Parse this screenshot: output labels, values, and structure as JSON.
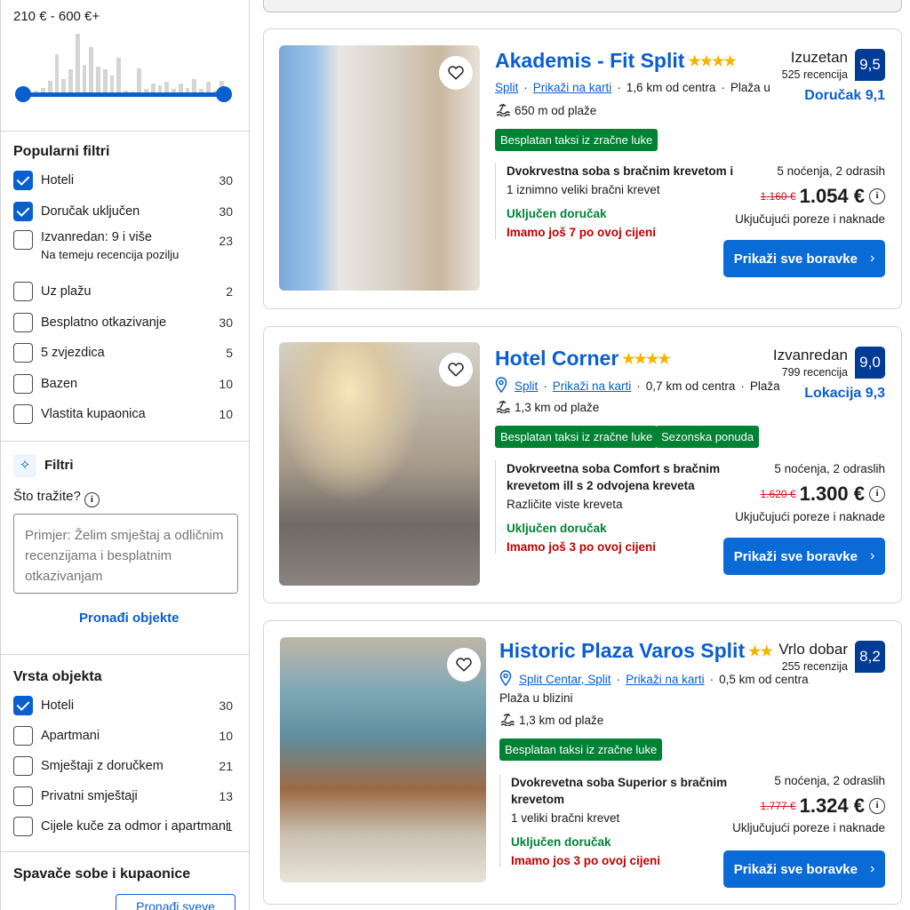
{
  "sidebar": {
    "price_range": "210 € - 600 €+",
    "price_histogram": [
      2,
      5,
      8,
      12,
      22,
      60,
      25,
      38,
      90,
      45,
      70,
      42,
      38,
      30,
      55,
      8,
      6,
      40,
      10,
      18,
      15,
      20,
      10,
      18,
      12,
      25,
      10,
      20,
      8,
      22
    ],
    "popular": {
      "title": "Popularni filtri",
      "items": [
        {
          "label": "Hoteli",
          "count": "30",
          "checked": true
        },
        {
          "label": "Doručak uključen",
          "count": "30",
          "checked": true
        },
        {
          "label": "Izvanredan: 9 i više",
          "sublabel": "Na temeju recencija pozilju",
          "count": "23",
          "checked": false
        },
        {
          "label": "Uz plažu",
          "count": "2",
          "checked": false
        },
        {
          "label": "Besplatno otkazivanje",
          "count": "30",
          "checked": false
        },
        {
          "label": "5 zvjezdica",
          "count": "5",
          "checked": false
        },
        {
          "label": "Bazen",
          "count": "10",
          "checked": false
        },
        {
          "label": "Vlastita kupaonica",
          "count": "10",
          "checked": false
        }
      ]
    },
    "ai_filter": {
      "title": "Filtri",
      "question": "Što tražite?",
      "placeholder": "Primjer: Želim smještaj a odličnim recenzijama i besplatnim otkazivanjam",
      "find_label": "Pronađi objekte"
    },
    "property_type": {
      "title": "Vrsta objekta",
      "items": [
        {
          "label": "Hoteli",
          "count": "30",
          "checked": true
        },
        {
          "label": "Apartmani",
          "count": "10",
          "checked": false
        },
        {
          "label": "Smještaji z doručkem",
          "count": "21",
          "checked": false
        },
        {
          "label": "Privatni smještaji",
          "count": "13",
          "checked": false
        },
        {
          "label": "Cijele kuče za odmor i apartmani",
          "count": "1",
          "checked": false
        }
      ]
    },
    "rooms": {
      "title": "Spavače sobe i kupaonice",
      "button_label": "Pronađi sveve"
    }
  },
  "results": [
    {
      "name": "Akademis - Fit Split",
      "stars": "★★★★",
      "review_word": "Izuzetan",
      "review_count": "525 recencija",
      "score": "9,5",
      "sub_score": "Doručak 9,1",
      "location": [
        "Split",
        "Prikaži na karti",
        "1,6 km od centra",
        "Plaža u"
      ],
      "beach": "650 m od plaže",
      "badges": [
        "Besplatan taksi iz zračne luke"
      ],
      "room_name": "Dvokrvestna soba s bračnim krevetom i",
      "room_beds": "1 iznimno veliki bračni krevet",
      "breakfast": "Uključen doručak",
      "scarcity": "Imamo još 7 po ovoj cijeni",
      "nights": "5 noćenja, 2 odrasih",
      "old_price": "1.160 €",
      "new_price": "1.054 €",
      "taxes": "Ukjučujući poreze i naknade",
      "cta": "Prikaži sve boravke"
    },
    {
      "name": "Hotel Corner",
      "stars": "★★★★",
      "review_word": "Izvanredan",
      "review_count": "799 recencija",
      "score": "9,0",
      "sub_score": "Lokacija 9,3",
      "location": [
        "Split",
        "Prikaži na karti",
        "0,7 km od centra",
        "Plaža"
      ],
      "beach": "1,3 km od plaže",
      "badges": [
        "Besplatan taksi iz zračne luke",
        "Sezonska ponuda"
      ],
      "room_name": "Dvokrveetna soba Comfort s bračnim krevetom ill s 2 odvojena kreveta",
      "room_beds": "Različite viste kreveta",
      "breakfast": "Uključen doručak",
      "scarcity": "Imamo još 3 po ovoj cijeni",
      "nights": "5 noćenja, 2 odraslih",
      "old_price": "1.620 €",
      "new_price": "1.300 €",
      "taxes": "Ukjučujući poreze i naknade",
      "cta": "Prikaži sve boravke"
    },
    {
      "name": "Historic Plaza Varos Split",
      "stars": "★★",
      "review_word": "Vrlo dobar",
      "review_count": "255 recenzija",
      "score": "8,2",
      "sub_score": "",
      "location": [
        "Split Centar, Split",
        "Prikaži na karti",
        "0,5 km od centra"
      ],
      "location_extra": "Plaža u blizini",
      "beach": "1,3 km od plaže",
      "badges": [
        "Besplatan taksi iz zračne luke"
      ],
      "room_name": "Dvokrevetna soba Superior s bračnim krevetom",
      "room_beds": "1 veliki bračni krevet",
      "breakfast": "Uključen doručak",
      "scarcity": "Imamo jos 3 po ovoj cijeni",
      "nights": "5 noćenja, 2 odraslih",
      "old_price": "1.777 €",
      "new_price": "1.324 €",
      "taxes": "Uključujući poreze i naknade",
      "cta": "Prikaži sve boravke"
    }
  ],
  "colors": {
    "accent_blue": "#0a5fd0",
    "score_navy": "#003b95",
    "badge_green": "#008234",
    "alert_red": "#c00000",
    "star_gold": "#f5b400"
  }
}
